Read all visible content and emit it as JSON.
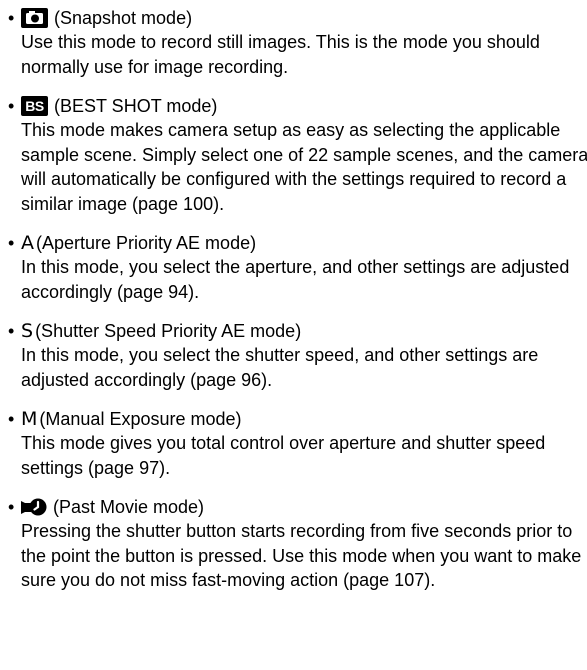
{
  "bullet_char": "•",
  "items": [
    {
      "icon": "camera-icon",
      "label": "(Snapshot mode)",
      "description": "Use this mode to record still images. This is the mode you should normally use for image recording."
    },
    {
      "icon": "best-shot-icon",
      "icon_text": "BS",
      "label": "(BEST SHOT mode)",
      "description": "This mode makes camera setup as easy as selecting the applicable sample scene. Simply select one of 22 sample scenes, and the camera will automatically be configured with the settings required to record a similar image (page 100)."
    },
    {
      "icon": "aperture-letter-icon",
      "icon_text": "A",
      "label": "(Aperture Priority AE mode)",
      "description": "In this mode, you select the aperture, and other settings are adjusted accordingly (page 94)."
    },
    {
      "icon": "shutter-letter-icon",
      "icon_text": "S",
      "label": "(Shutter Speed Priority AE mode)",
      "description": "In this mode, you select the shutter speed, and other settings are adjusted accordingly (page 96)."
    },
    {
      "icon": "manual-letter-icon",
      "icon_text": "M",
      "label": "(Manual Exposure mode)",
      "description": "This mode gives you total control over aperture and shutter speed settings (page 97)."
    },
    {
      "icon": "past-movie-icon",
      "label": "(Past Movie mode)",
      "description": "Pressing the shutter button starts recording from five seconds prior to the point the button is pressed. Use this mode when you want to make sure you do not miss fast-moving action (page 107)."
    }
  ]
}
